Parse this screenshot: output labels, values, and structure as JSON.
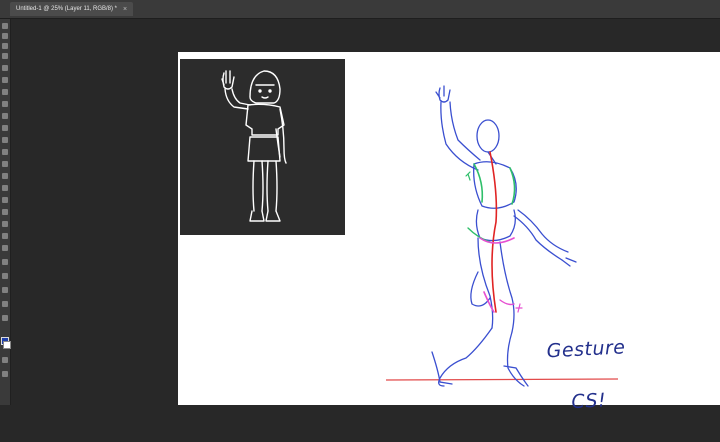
{
  "document_tab": {
    "title": "Untitled-1 @ 25% (Layer 11, RGB/8) *",
    "close_glyph": "×"
  },
  "toolbar": {
    "foreground_color": "#1f3fa8",
    "background_color": "#ffffff"
  },
  "reference_panel": {
    "background": "#2c2c2c",
    "line_color": "#ffffff"
  },
  "canvas": {
    "background": "#ffffff",
    "annotation": {
      "line1": "Gesture",
      "line2": "CS!",
      "color": "#23308c"
    },
    "ground_line_color": "#e24a4a",
    "stroke_colors": {
      "construction": "#3a4fd0",
      "gesture_line": "#e02424",
      "ribcage": "#2fbf6a",
      "pelvis": "#e64fd1"
    }
  }
}
